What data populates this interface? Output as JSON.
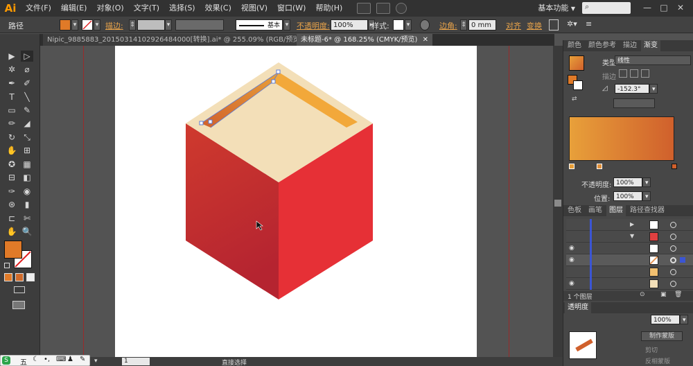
{
  "app_logo": "Ai",
  "menu": [
    "文件(F)",
    "编辑(E)",
    "对象(O)",
    "文字(T)",
    "选择(S)",
    "效果(C)",
    "视图(V)",
    "窗口(W)",
    "帮助(H)"
  ],
  "workspace": "基本功能",
  "workspace_arrow": "▼",
  "window_controls": {
    "minimize": "—",
    "maximize": "□",
    "close": "✕"
  },
  "control_bar": {
    "selection_type": "路径",
    "stroke_label": "描边:",
    "stroke_style": "基本",
    "opacity_label": "不透明度:",
    "opacity_value": "100%",
    "style_label": "样式:",
    "corner_label": "边角:",
    "corner_value": "0 mm",
    "align_label": "对齐",
    "transform_label": "变换"
  },
  "tabs": [
    {
      "label": "Nipic_9885883_20150314102926484000[转换].ai* @ 255.09% (RGB/预览)",
      "active": false
    },
    {
      "label": "未标题-6* @ 168.25% (CMYK/预览)",
      "active": true
    }
  ],
  "tab_close": "✕",
  "tools": [
    "▶",
    "▷",
    "✲",
    "⌀",
    "✒",
    "✐",
    "T",
    "╲",
    "▭",
    "✎",
    "✏",
    "◢",
    "↻",
    "⤡",
    "✋",
    "⊞",
    "✪",
    "▦",
    "⊟",
    "◧",
    "✑",
    "◉",
    "⊛",
    "▮",
    "⊏",
    "✄",
    "✋",
    "🔍"
  ],
  "colors": {
    "fill_swatch": "#e07a28",
    "gradient_start": "#e8a03a",
    "gradient_end": "#d0602c",
    "box_top": "#f3dfb8",
    "box_left_top": "#cf3a2e",
    "box_left_bottom": "#b52430",
    "box_right": "#e63036",
    "strip_a": "#d2732c",
    "strip_b": "#f2a83a"
  },
  "gradient_panel": {
    "tabs": [
      "颜色",
      "颜色参考",
      "描边",
      "渐变"
    ],
    "type_label": "类型:",
    "type_value": "线性",
    "stroke_label": "描边",
    "angle_value": "-152.3°",
    "opacity_label": "不透明度:",
    "opacity_value": "100%",
    "location_label": "位置:",
    "location_value": "100%"
  },
  "layers_panel": {
    "tabs": [
      "色板",
      "画笔",
      "图层",
      "路径查找器"
    ],
    "footer": "1 个图层",
    "rows": 6
  },
  "transparency_panel": {
    "title": "透明度",
    "opacity_value": "100%",
    "make_mask": "制作蒙版",
    "clip": "剪切",
    "invert_mask": "反相蒙版"
  },
  "status_bar": {
    "zoom": "168.25%",
    "page": "1",
    "tool_name": "直接选择"
  },
  "ime_bar": {
    "label": "五"
  }
}
